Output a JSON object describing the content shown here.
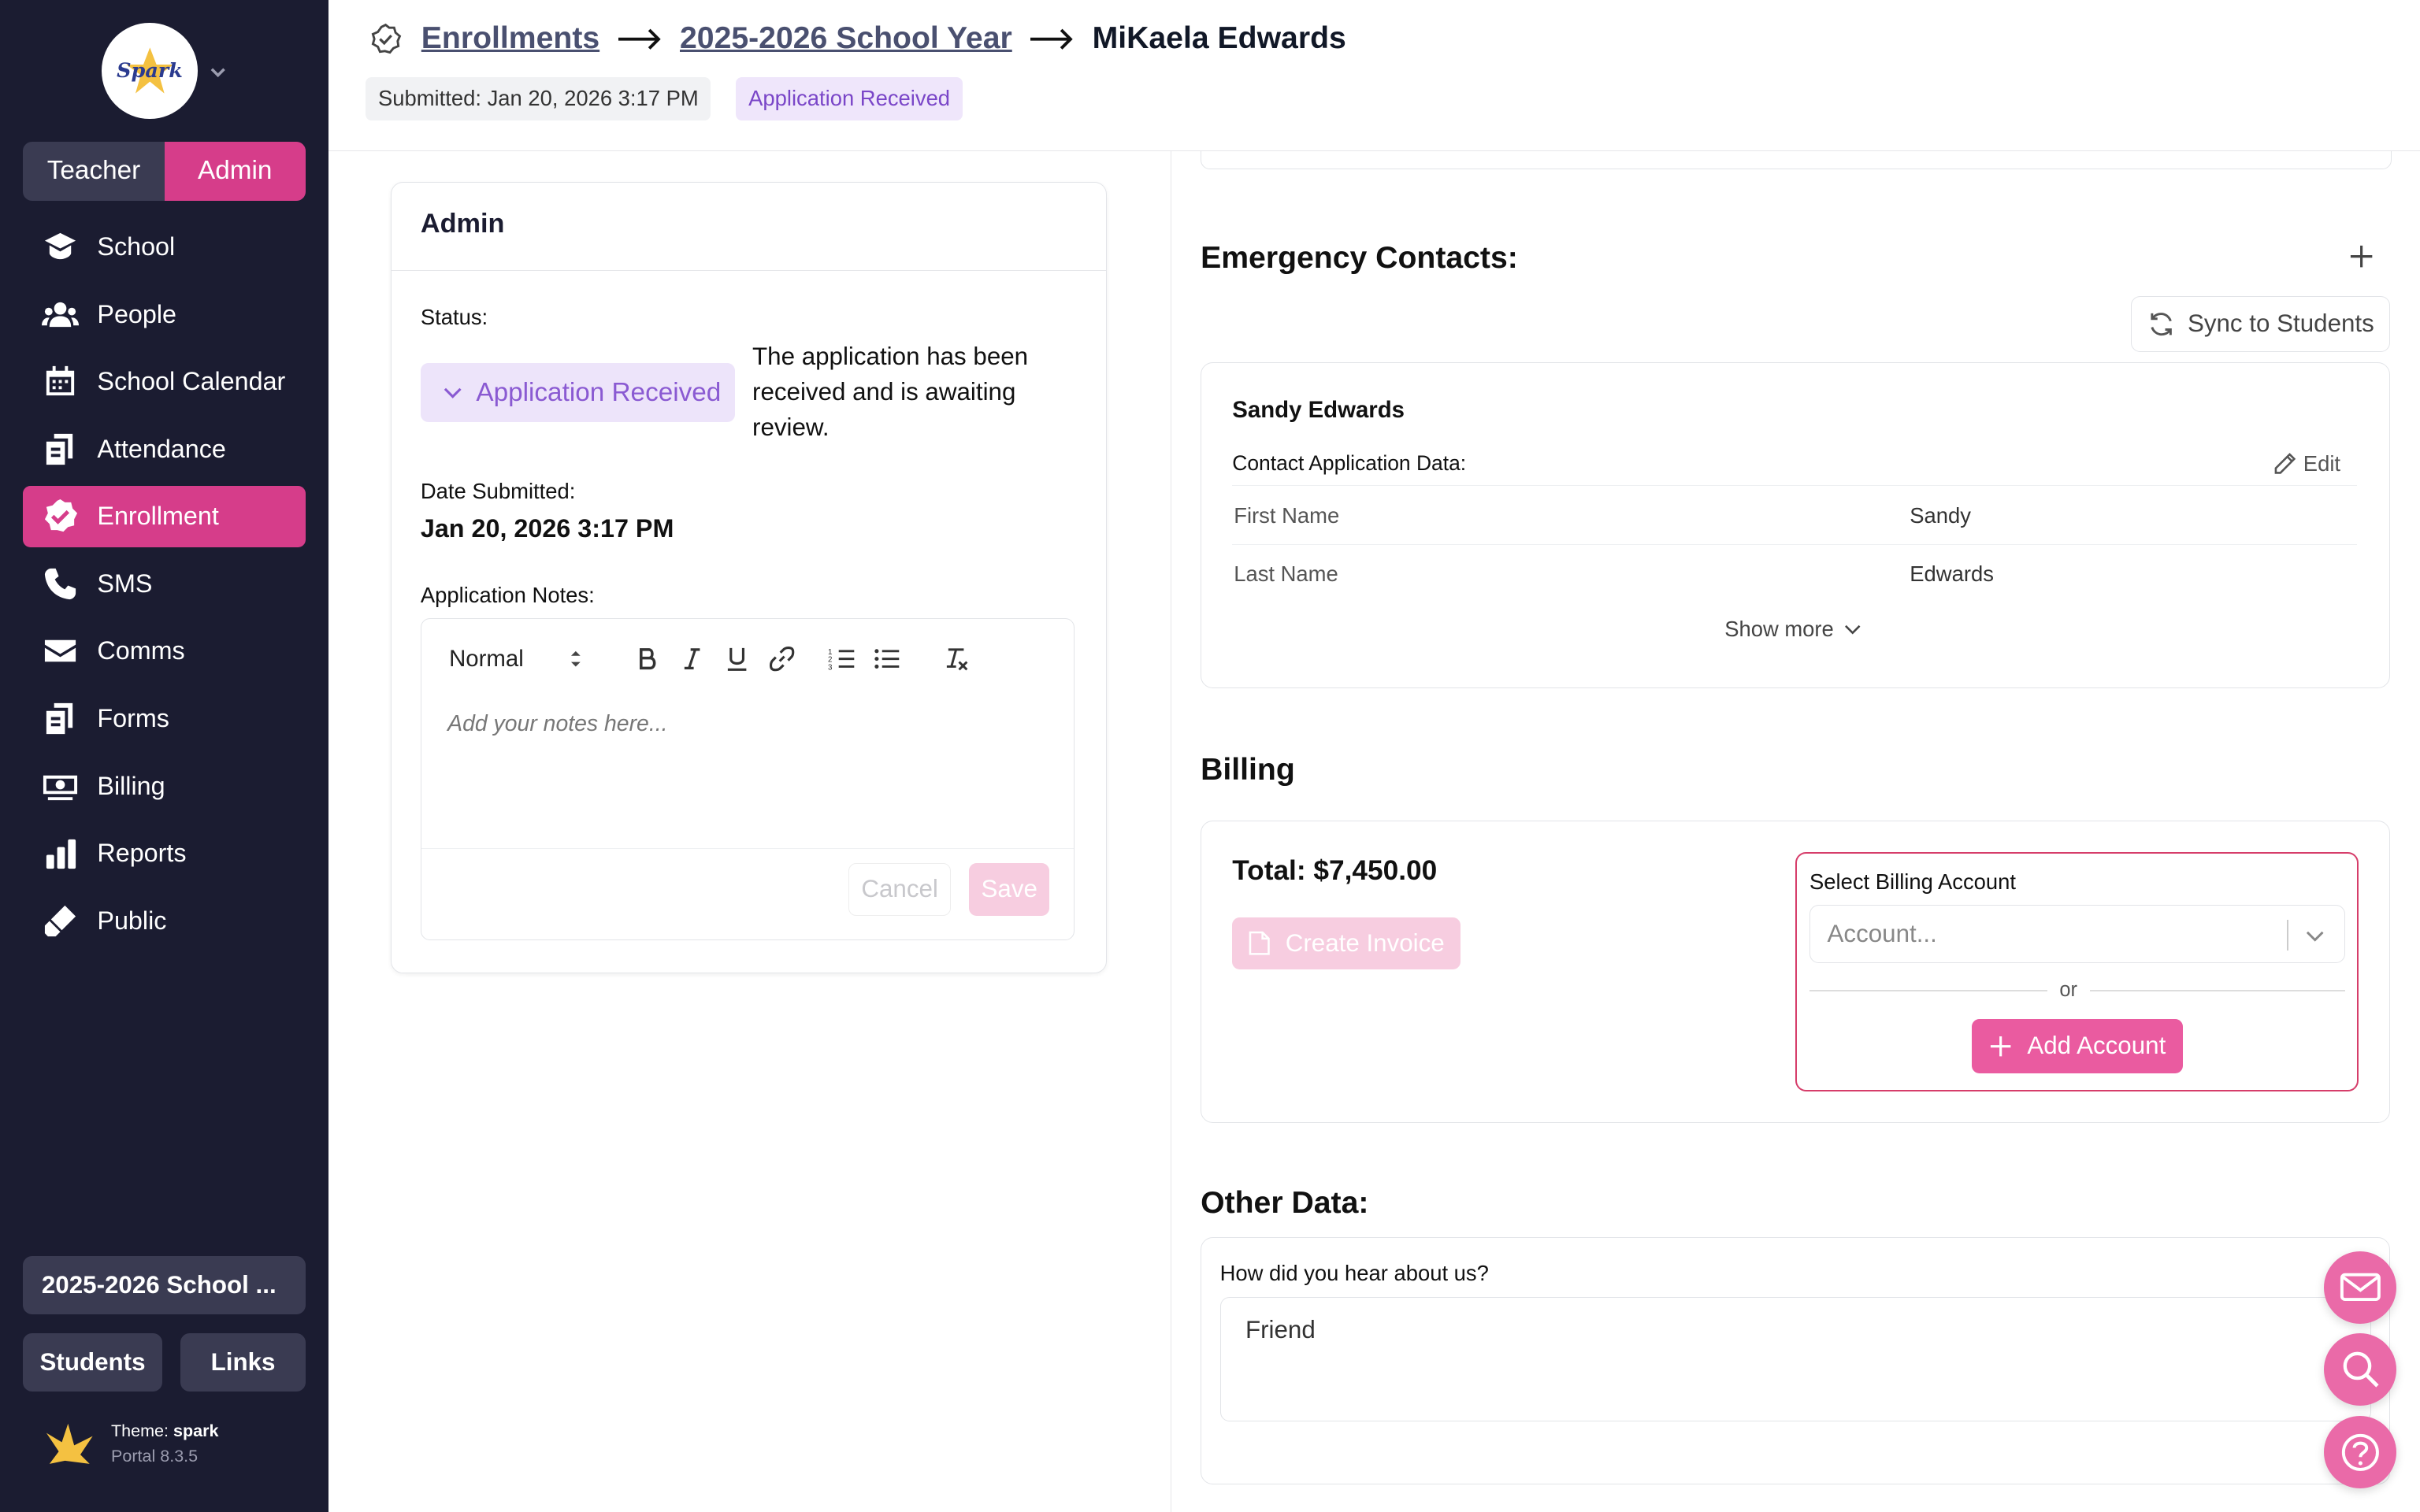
{
  "sidebar": {
    "logo_text": "Spark",
    "role_toggle": [
      "Teacher",
      "Admin"
    ],
    "active_role": "Admin",
    "nav": [
      {
        "label": "School",
        "icon": "school-icon"
      },
      {
        "label": "People",
        "icon": "people-icon"
      },
      {
        "label": "School Calendar",
        "icon": "calendar-icon"
      },
      {
        "label": "Attendance",
        "icon": "attendance-icon"
      },
      {
        "label": "Enrollment",
        "icon": "enrollment-icon",
        "active": true
      },
      {
        "label": "SMS",
        "icon": "phone-icon"
      },
      {
        "label": "Comms",
        "icon": "mail-icon"
      },
      {
        "label": "Forms",
        "icon": "forms-icon"
      },
      {
        "label": "Billing",
        "icon": "billing-icon"
      },
      {
        "label": "Reports",
        "icon": "reports-icon"
      },
      {
        "label": "Public",
        "icon": "public-icon"
      }
    ],
    "year_selector": "2025-2026 School ...",
    "students_button": "Students",
    "links_button": "Links",
    "theme_label": "Theme:",
    "theme_name": "spark",
    "version": "Portal 8.3.5"
  },
  "header": {
    "breadcrumb": [
      "Enrollments",
      "2025-2026 School Year",
      "MiKaela Edwards"
    ],
    "submitted": "Submitted: Jan 20, 2026 3:17 PM",
    "status_badge": "Application Received"
  },
  "admin_card": {
    "title": "Admin",
    "status_label": "Status:",
    "status_value": "Application Received",
    "status_description": "The application has been received and is awaiting review.",
    "date_label": "Date Submitted:",
    "date_value": "Jan 20, 2026 3:17 PM",
    "notes_label": "Application Notes:",
    "format_select": "Normal",
    "notes_placeholder": "Add your notes here...",
    "cancel": "Cancel",
    "save": "Save"
  },
  "emergency": {
    "title": "Emergency Contacts:",
    "sync_button": "Sync to Students",
    "contact_name": "Sandy Edwards",
    "section_label": "Contact Application Data:",
    "edit": "Edit",
    "rows": [
      {
        "key": "First Name",
        "value": "Sandy"
      },
      {
        "key": "Last Name",
        "value": "Edwards"
      }
    ],
    "show_more": "Show more"
  },
  "billing": {
    "title": "Billing",
    "total": "Total: $7,450.00",
    "create_invoice": "Create Invoice",
    "select_label": "Select Billing Account",
    "select_placeholder": "Account...",
    "or": "or",
    "add_account": "Add Account"
  },
  "other": {
    "title": "Other Data:",
    "question": "How did you hear about us?",
    "answer": "Friend"
  },
  "colors": {
    "sidebar_bg": "#1b1c31",
    "accent": "#d63d8a",
    "status_purple": "#8a5ad2",
    "fab_pink": "#ea6aa8"
  }
}
